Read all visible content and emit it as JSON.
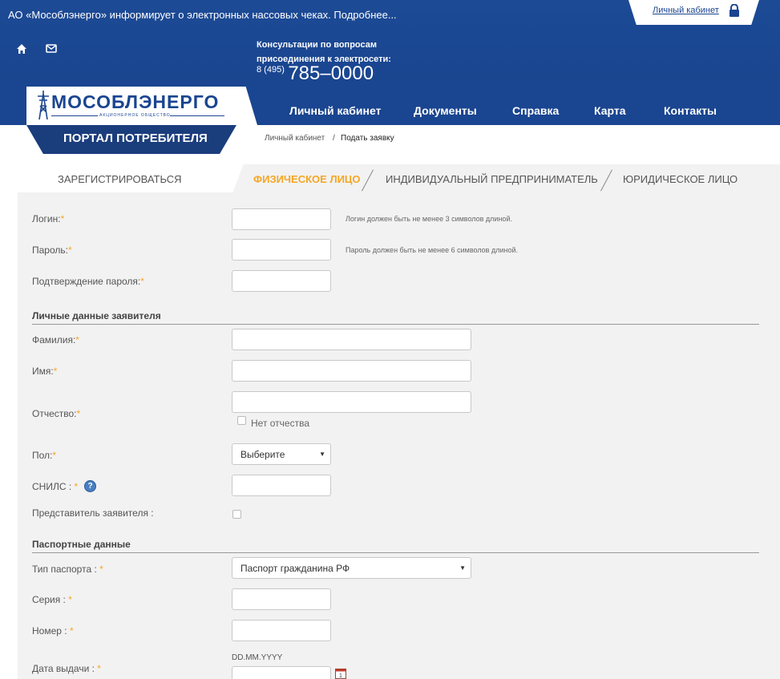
{
  "header": {
    "announcement": "АО «Мособлэнерго» информирует о электронных нассовых чеках. Подробнее...",
    "cabinet_link": "Личный кабинет",
    "consult_line1": "Консультации по вопросам",
    "consult_line2": "присоединения к электросети:",
    "phone_code": "8 (495)",
    "phone_number": "785–0000"
  },
  "logo": {
    "name": "МОСОБЛЭНЕРГО",
    "subtitle": "АКЦИОНЕРНОЕ ОБЩЕСТВО"
  },
  "nav": {
    "items": [
      "Личный кабинет",
      "Документы",
      "Справка",
      "Карта",
      "Контакты"
    ]
  },
  "portal_label": "ПОРТАЛ ПОТРЕБИТЕЛЯ",
  "breadcrumb": {
    "home": "Личный кабинет",
    "separator": "/",
    "current": "Подать заявку"
  },
  "tabs": {
    "register": "ЗАРЕГИСТРИРОВАТЬСЯ",
    "items": [
      "ФИЗИЧЕСКОЕ ЛИЦО",
      "ИНДИВИДУАЛЬНЫЙ ПРЕДПРИНИМАТЕЛЬ",
      "ЮРИДИЧЕСКОЕ ЛИЦО"
    ],
    "active": "ФИЗИЧЕСКОЕ ЛИЦО"
  },
  "form": {
    "login_label": "Логин:",
    "login_hint": "Логин должен быть не менее 3 символов длиной.",
    "password_label": "Пароль:",
    "password_hint": "Пароль должен быть не менее 6 символов длиной.",
    "confirm_label": "Подтверждение пароля:",
    "required_mark": "*",
    "section_personal": "Личные данные заявителя",
    "surname_label": "Фамилия:",
    "name_label": "Имя:",
    "patronymic_label": "Отчество:",
    "no_patronymic": "Нет отчества",
    "gender_label": "Пол:",
    "gender_value": "Выберите",
    "snils_label": "СНИЛС :",
    "representative_label": "Представитель заявителя :",
    "section_passport": "Паспортные данные",
    "passport_type_label": "Тип паспорта :",
    "passport_type_value": "Паспорт гражданина РФ",
    "series_label": "Серия :",
    "number_label": "Номер :",
    "issue_date_label": "Дата выдачи :",
    "date_format": "DD.MM.YYYY",
    "help_glyph": "?",
    "calendar_day": "1"
  },
  "colors": {
    "brand_blue": "#1a4590",
    "accent_orange": "#f6a623",
    "panel_bg": "#f2f2f2"
  }
}
